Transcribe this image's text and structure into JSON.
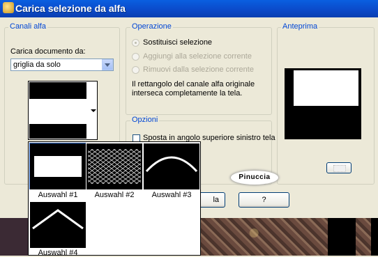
{
  "window": {
    "title": "Carica selezione da alfa"
  },
  "alpha_group": {
    "legend": "Canali alfa",
    "load_label": "Carica documento da:",
    "document_value": "griglia da solo"
  },
  "operation_group": {
    "legend": "Operazione",
    "options": [
      {
        "label": "Sostituisci selezione",
        "checked": true
      },
      {
        "label": "Aggiungi alla selezione corrente",
        "checked": false
      },
      {
        "label": "Rimuovi dalla selezione corrente",
        "checked": false
      }
    ],
    "note_line1": "Il rettangolo del canale alfa originale",
    "note_line2": "interseca completamente la tela."
  },
  "options_group": {
    "legend": "Opzioni",
    "checkbox_label": "Sposta in angolo superiore sinistro tela",
    "checkbox_checked": false
  },
  "preview_group": {
    "legend": "Anteprima"
  },
  "buttons": {
    "cancel_fragment": "la",
    "help": "?"
  },
  "watermark": "Pinuccia",
  "gallery": {
    "selected_index": 0,
    "items": [
      {
        "label": "Auswahl #1",
        "pattern": "band"
      },
      {
        "label": "Auswahl #2",
        "pattern": "mesh"
      },
      {
        "label": "Auswahl #3",
        "pattern": "arch"
      },
      {
        "label": "Auswahl #4",
        "pattern": "roof"
      }
    ]
  },
  "colors": {
    "title_bar": "#0b49c8",
    "legend_text": "#0046d5",
    "selection": "#316ac5"
  }
}
